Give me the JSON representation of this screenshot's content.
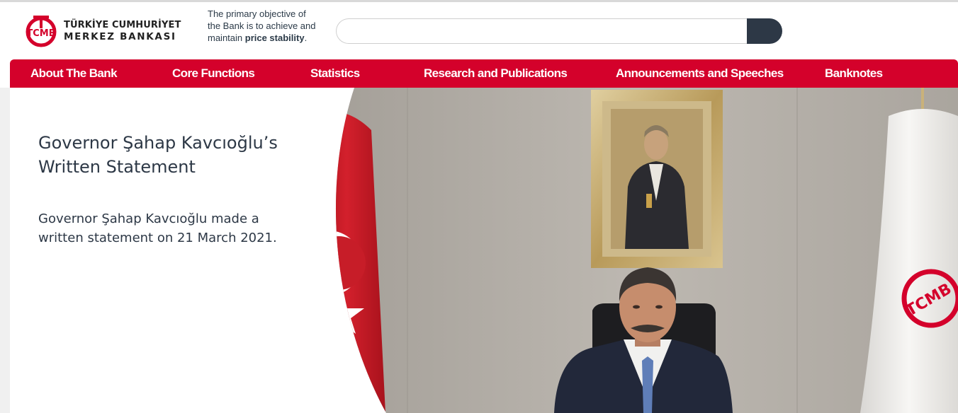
{
  "header": {
    "logo": {
      "line1": "TÜRKİYE CUMHURİYET",
      "line2": "MERKEZ BANKASI",
      "emblem": "TCMB"
    },
    "tagline": {
      "text": "The primary objective of the Bank is to achieve and maintain ",
      "emphasis": "price stability",
      "end": "."
    },
    "search": {
      "placeholder": "",
      "value": "",
      "button_icon": "search-icon"
    }
  },
  "nav": {
    "items": [
      {
        "label": "About The Bank"
      },
      {
        "label": "Core Functions"
      },
      {
        "label": "Statistics"
      },
      {
        "label": "Research and Publications"
      },
      {
        "label": "Announcements and Speeches"
      },
      {
        "label": "Banknotes"
      }
    ]
  },
  "hero": {
    "title": "Governor Şahap Kavcıoğlu’s Written Statement",
    "description": "Governor Şahap Kavcıoğlu made a written statement on 21 March 2021.",
    "image": {
      "flag_emblem_text": "TCMB"
    }
  },
  "colors": {
    "brand_red": "#d4012b",
    "search_button": "#2d3846",
    "text_dark": "#2d3846"
  }
}
